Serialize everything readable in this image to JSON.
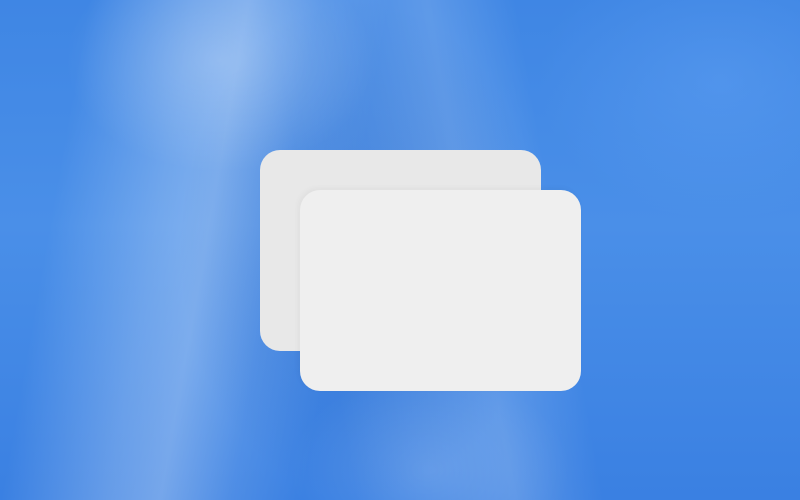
{
  "wallpaper": {
    "base_color": "#4189e6",
    "highlight_color": "#8fb8f0"
  },
  "windows": {
    "back_color": "#e8e8e8",
    "front_color": "#efefef",
    "count": 2
  }
}
